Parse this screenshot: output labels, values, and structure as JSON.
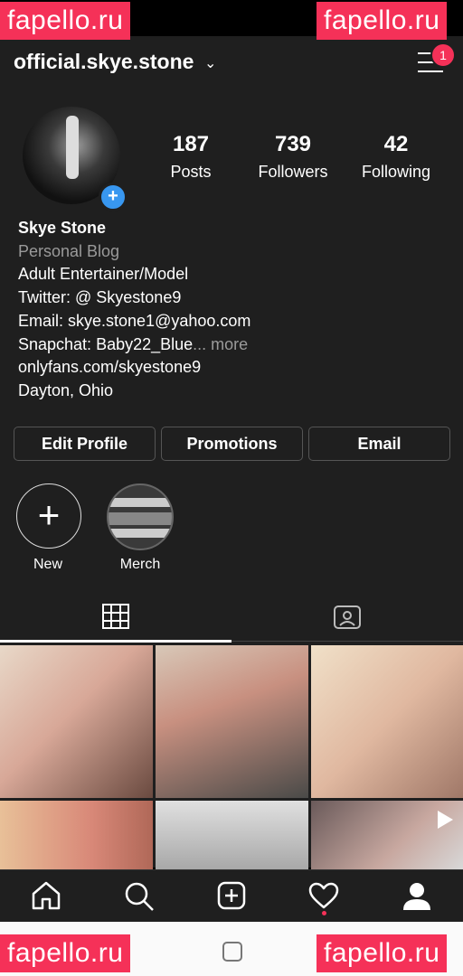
{
  "watermark": "fapello.ru",
  "header": {
    "username": "official.skye.stone",
    "notification_count": "1"
  },
  "stats": [
    {
      "value": "187",
      "label": "Posts"
    },
    {
      "value": "739",
      "label": "Followers"
    },
    {
      "value": "42",
      "label": "Following"
    }
  ],
  "bio": {
    "name": "Skye Stone",
    "category": "Personal Blog",
    "lines": [
      "Adult Entertainer/Model",
      "Twitter: @ Skyestone9",
      "Email: skye.stone1@yahoo.com"
    ],
    "snapchat": "Snapchat: Baby22_Blue",
    "more": "... more",
    "link": "onlyfans.com/skyestone9",
    "location": "Dayton, Ohio"
  },
  "buttons": {
    "edit_profile": "Edit Profile",
    "promotions": "Promotions",
    "email": "Email"
  },
  "highlights": {
    "new_label": "New",
    "merch_label": "Merch"
  },
  "icons": {
    "grid_tab": "grid-icon",
    "tagged_tab": "tagged-icon",
    "nav": [
      "home-icon",
      "search-icon",
      "add-post-icon",
      "heart-icon",
      "profile-icon"
    ]
  },
  "colors": {
    "background": "#1f1f1f",
    "accent_blue": "#3897f0",
    "badge_red": "#f53158"
  }
}
